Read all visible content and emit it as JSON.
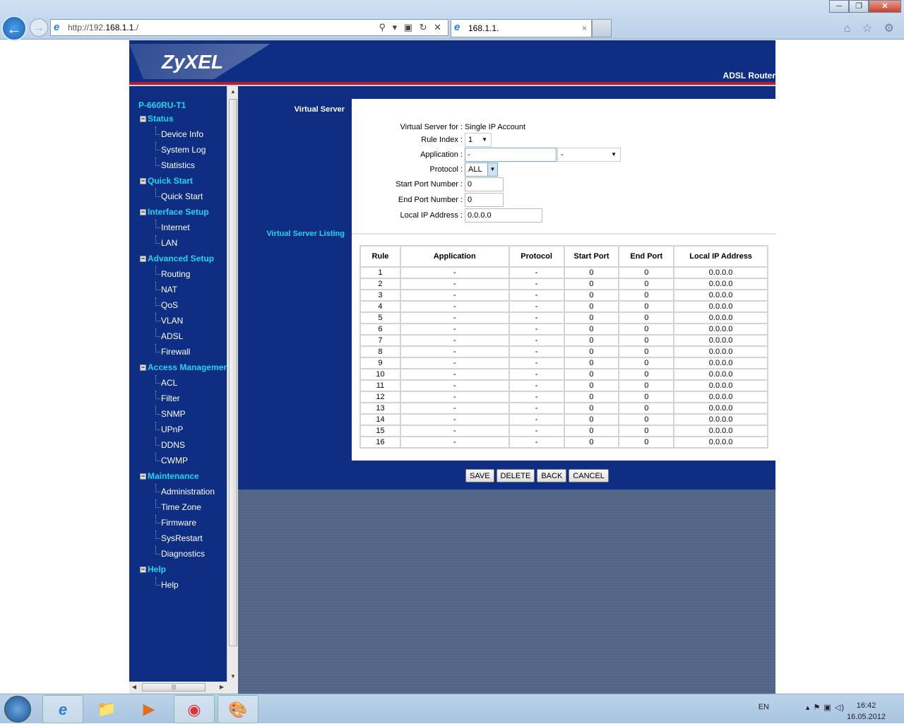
{
  "browser": {
    "url_prefix": "http://192.",
    "url_host": "168.1.1.",
    "url_suffix": "/",
    "tab_title": "168.1.1.",
    "addr_tools": "⚲ ▾ ▣ ↻ ✕",
    "tab_close": "×",
    "right_tools": "⌂ ☆ ⚙",
    "min": "─",
    "max": "❐",
    "close": "✕",
    "back": "←",
    "fwd": "→",
    "ie": "e"
  },
  "header": {
    "logo": "ZyXEL",
    "product": "ADSL Router"
  },
  "sidebar": {
    "title": "P-660RU-T1",
    "items": [
      {
        "label": "Status",
        "top": true
      },
      {
        "label": "Device Info"
      },
      {
        "label": "System Log"
      },
      {
        "label": "Statistics"
      },
      {
        "label": "Quick Start",
        "top": true
      },
      {
        "label": "Quick Start"
      },
      {
        "label": "Interface Setup",
        "top": true
      },
      {
        "label": "Internet"
      },
      {
        "label": "LAN"
      },
      {
        "label": "Advanced Setup",
        "top": true
      },
      {
        "label": "Routing"
      },
      {
        "label": "NAT"
      },
      {
        "label": "QoS"
      },
      {
        "label": "VLAN"
      },
      {
        "label": "ADSL"
      },
      {
        "label": "Firewall"
      },
      {
        "label": "Access Management",
        "top": true
      },
      {
        "label": "ACL"
      },
      {
        "label": "Filter"
      },
      {
        "label": "SNMP"
      },
      {
        "label": "UPnP"
      },
      {
        "label": "DDNS"
      },
      {
        "label": "CWMP"
      },
      {
        "label": "Maintenance",
        "top": true
      },
      {
        "label": "Administration"
      },
      {
        "label": "Time Zone"
      },
      {
        "label": "Firmware"
      },
      {
        "label": "SysRestart"
      },
      {
        "label": "Diagnostics"
      },
      {
        "label": "Help",
        "top": true
      },
      {
        "label": "Help"
      }
    ]
  },
  "main": {
    "section1": "Virtual Server",
    "section2": "Virtual Server Listing",
    "form": {
      "vs_for_label": "Virtual Server for :",
      "vs_for_value": "Single IP Account",
      "rule_index_label": "Rule Index :",
      "rule_index_value": "1",
      "application_label": "Application :",
      "application_value": "-",
      "application_select": "-",
      "protocol_label": "Protocol :",
      "protocol_value": "ALL",
      "start_port_label": "Start Port Number :",
      "start_port_value": "0",
      "end_port_label": "End Port Number :",
      "end_port_value": "0",
      "local_ip_label": "Local IP Address :",
      "local_ip_value": "0.0.0.0"
    },
    "table": {
      "headers": [
        "Rule",
        "Application",
        "Protocol",
        "Start Port",
        "End Port",
        "Local IP Address"
      ],
      "rows": [
        [
          "1",
          "-",
          "-",
          "0",
          "0",
          "0.0.0.0"
        ],
        [
          "2",
          "-",
          "-",
          "0",
          "0",
          "0.0.0.0"
        ],
        [
          "3",
          "-",
          "-",
          "0",
          "0",
          "0.0.0.0"
        ],
        [
          "4",
          "-",
          "-",
          "0",
          "0",
          "0.0.0.0"
        ],
        [
          "5",
          "-",
          "-",
          "0",
          "0",
          "0.0.0.0"
        ],
        [
          "6",
          "-",
          "-",
          "0",
          "0",
          "0.0.0.0"
        ],
        [
          "7",
          "-",
          "-",
          "0",
          "0",
          "0.0.0.0"
        ],
        [
          "8",
          "-",
          "-",
          "0",
          "0",
          "0.0.0.0"
        ],
        [
          "9",
          "-",
          "-",
          "0",
          "0",
          "0.0.0.0"
        ],
        [
          "10",
          "-",
          "-",
          "0",
          "0",
          "0.0.0.0"
        ],
        [
          "11",
          "-",
          "-",
          "0",
          "0",
          "0.0.0.0"
        ],
        [
          "12",
          "-",
          "-",
          "0",
          "0",
          "0.0.0.0"
        ],
        [
          "13",
          "-",
          "-",
          "0",
          "0",
          "0.0.0.0"
        ],
        [
          "14",
          "-",
          "-",
          "0",
          "0",
          "0.0.0.0"
        ],
        [
          "15",
          "-",
          "-",
          "0",
          "0",
          "0.0.0.0"
        ],
        [
          "16",
          "-",
          "-",
          "0",
          "0",
          "0.0.0.0"
        ]
      ]
    },
    "buttons": {
      "save": "SAVE",
      "delete": "DELETE",
      "back": "BACK",
      "cancel": "CANCEL"
    }
  },
  "taskbar": {
    "lang": "EN",
    "tray_icons": "▴  ⚑  ▣  ◁)",
    "time": "16:42",
    "date": "16.05.2012",
    "apps": [
      "e",
      "📁",
      "▶",
      "◉",
      "🎨"
    ]
  },
  "scroll": {
    "up": "▲",
    "down": "▼",
    "left": "◀",
    "right": "▶",
    "grip": "|||"
  }
}
